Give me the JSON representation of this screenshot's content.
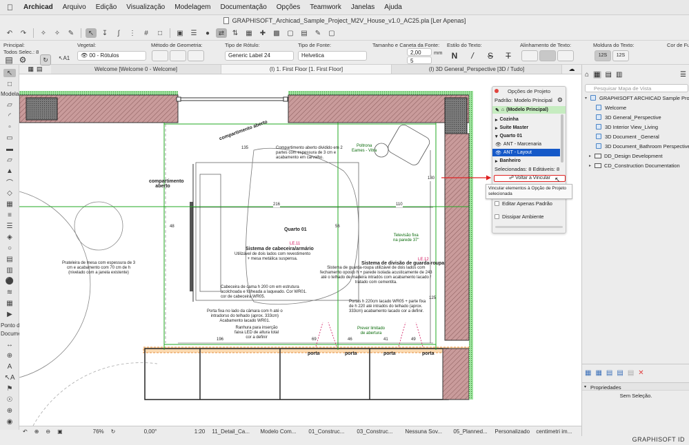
{
  "menubar": {
    "items": [
      "Archicad",
      "Arquivo",
      "Edição",
      "Visualização",
      "Modelagem",
      "Documentação",
      "Opções",
      "Teamwork",
      "Janelas",
      "Ajuda"
    ]
  },
  "window": {
    "title": "GRAPHISOFT_Archicad_Sample_Project_M2V_House_v1.0_AC25.pla [Ler Apenas]"
  },
  "infobox": {
    "principal_label": "Principal:",
    "principal_value": "Todos Selec.: 8",
    "vegetal_label": "Vegetal:",
    "vegetal_value": "00 - Rótulos",
    "geometry_label": "Método de Geometria:",
    "label_type_label": "Tipo de Rótulo:",
    "label_type_value": "Generic Label 24",
    "font_label": "Tipo de Fonte:",
    "font_value": "Helvetica",
    "size_label": "Tamanho e Caneta da Fonte:",
    "size_value": "2,00",
    "size_unit": "mm",
    "pen_value": "5",
    "text_style_label": "Estilo do Texto:",
    "align_label": "Alinhamento de Texto:",
    "frame_label": "Moldura do Texto:",
    "frame_value_1": "12S",
    "frame_value_2": "12S",
    "fill_label": "Cor de Fundo:"
  },
  "tabs": [
    {
      "label": "Welcome [Welcome 0 - Welcome]"
    },
    {
      "label": "(I) 1. First Floor [1. First Floor]"
    },
    {
      "label": "(I) 3D General_Perspective [3D / Tudo]"
    }
  ],
  "toolbox": {
    "modelagem_label": "Modelag",
    "ponto_label": "Ponto de",
    "docum_label": "Docume"
  },
  "drawing": {
    "annotations": {
      "compartimento_aberto_1": "compartimento aberto",
      "compartimento_aberto_2": "compartimento aberto",
      "comp_dividido": "Compartimento aberto dividido em 2\npartes com espessura de 3 cm e\nacabamento em carvalho.",
      "poltrona": "Poltrona\nEames - Vitra",
      "quarto": "Quarto 01",
      "le11": "LE.11",
      "le12": "LE.12",
      "cabeceira_title": "Sistema de cabeceira/armário",
      "cabeceira_desc": "Utilizável de dois lados com revestimento\n+ mesa metálica suspensa.",
      "guarda_roupa_title": "Sistema de divisão de guarda-roupa",
      "guarda_roupa_desc": "Sistema de guarda-roupa utilizável de dois lados com\nfechamento oposto h + parede isolada acusticamente de 243\naté o telhado de madeira intradós com acabamento lacado /\ntratado com cementita.",
      "prateleira": "Prateleira de mesa com espessura de 3\ncm e acabamento com 70 cm de h\n(nivelado com a janela existente)",
      "cabeceira_cama": "Cabeceira de cama h 200 cm em estrutura\nacolchoada e folheada a laqueado. Cor WR01.\ncor de cabeceira WR05.",
      "porta_fixa": "Porta fixa no lado da câmara com h até o\nintradorso do telhado (aprox. 333cm)\nAcabamento lacado WR01.",
      "ranhura": "Ranhura para inserção\nfaixa LED de altura total\ncor a definir",
      "portas_h": "Portas h 220cm lacado WR05 + parte fixa\nde h 220 até intradós do telhado (aprox.\n333cm) acabamento lacado cor a definir.",
      "televisao": "Televisão fixa\nna parede 37\"",
      "prever": "Prever limitado\nde abertura",
      "porta": "porta",
      "dims": [
        "216",
        "110",
        "135",
        "180",
        "196",
        "69",
        "46",
        "41",
        "49",
        "48",
        "56",
        "125"
      ]
    }
  },
  "project_options": {
    "title": "Opções de Projeto",
    "standard": "Padrão: Modelo Principal",
    "main_model": "(Modelo Principal)",
    "sets": [
      {
        "label": "Cozinha",
        "bold": true
      },
      {
        "label": "Suite Master",
        "bold": true
      },
      {
        "label": "Quarto 01",
        "bold": true
      },
      {
        "label": "ANT - Marcenaria",
        "bold": false
      },
      {
        "label": "ANT - Layout",
        "bold": false,
        "selected": true
      },
      {
        "label": "Banheiro",
        "bold": true
      }
    ],
    "selection_info": "Selecionadas: 8 Editáveis: 8",
    "relink_button": "Voltar a Vincular",
    "edit_only_main": "Editar Apenas Padrão",
    "dissipate": "Dissipar Ambiente"
  },
  "tooltip": {
    "text": "Vincular elementos à Opção de Projeto selecionada"
  },
  "navigator": {
    "search_placeholder": "Pesquisar Mapa de Vista",
    "root": "GRAPHISOFT ARCHICAD Sample Project - M",
    "items": [
      "Welcome",
      "3D General_Perspective",
      "3D Interior View_Living",
      "3D Document _General",
      "3D Document_Bathroom Perspective"
    ],
    "folders": [
      "DD_Design Development",
      "CD_Construction Documentation"
    ],
    "properties_title": "Propriedades",
    "no_selection": "Sem Seleção."
  },
  "statusbar": {
    "zoom": "76%",
    "angle": "0,00°",
    "scale": "1:20",
    "layer_combo": "11_Detail_Ca...",
    "model_view": "Modelo Com...",
    "pen_set": "01_Construc...",
    "graphic_override": "03_Construc...",
    "renovation": "Nessuna Sov...",
    "structure": "05_Planned...",
    "custom": "Personalizado",
    "dimension": "centimetri im..."
  },
  "branding": {
    "logo": "GRAPHISOFT ID"
  },
  "colors": {
    "wall_hatch": "#c99b9b",
    "green_line": "#22aa22",
    "selection_blue": "#1559c8",
    "red_arrow": "#e02020",
    "main_model_green": "#c6ecc0"
  }
}
